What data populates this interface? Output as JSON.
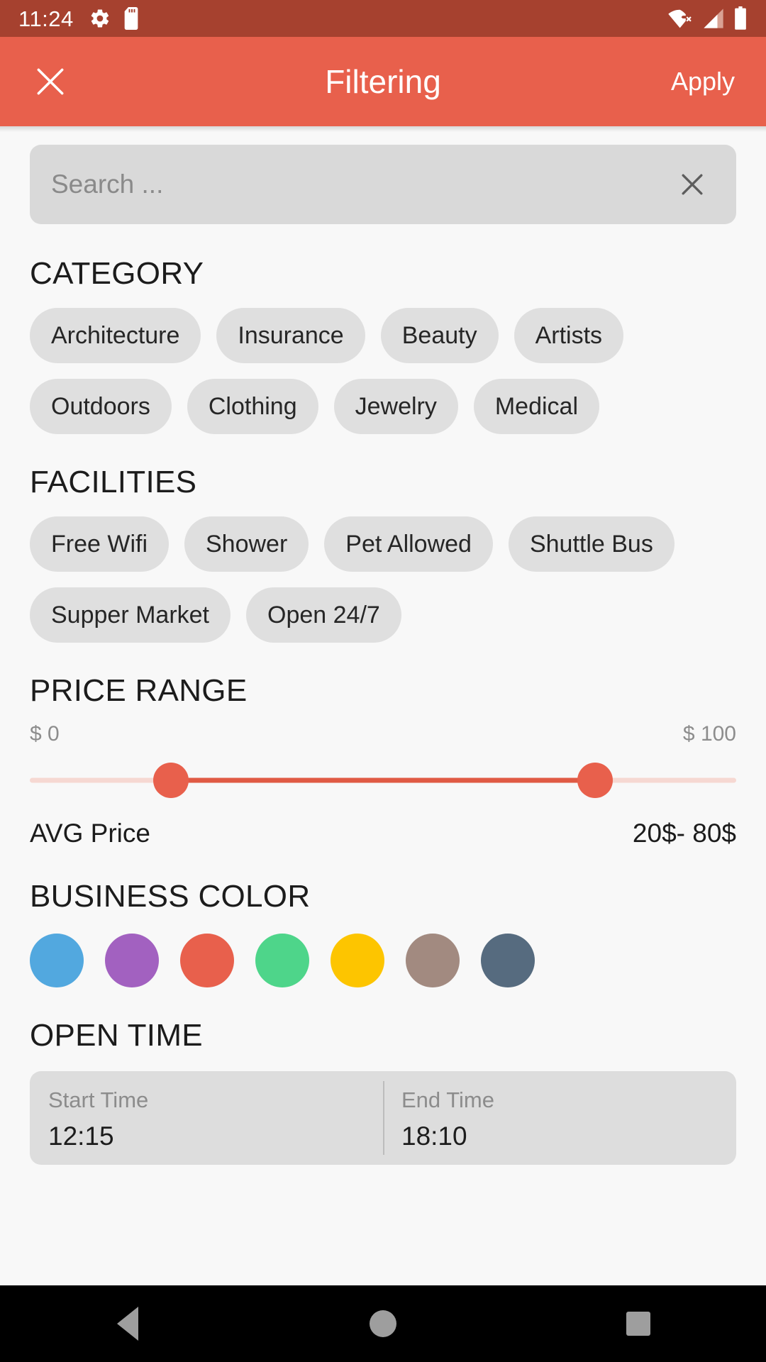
{
  "status_bar": {
    "time": "11:24",
    "icons": [
      "gear-icon",
      "sd-card-icon"
    ],
    "right_icons": [
      "wifi-off-icon",
      "cellular-signal-icon",
      "battery-icon"
    ],
    "background": "#a6412f"
  },
  "app_bar": {
    "close_label": "×",
    "title": "Filtering",
    "apply_label": "Apply",
    "background": "#e8604c"
  },
  "search": {
    "value": "",
    "placeholder": "Search ...",
    "clear_icon": "close-icon"
  },
  "category": {
    "title": "CATEGORY",
    "chips": [
      {
        "label": "Architecture",
        "selected": false
      },
      {
        "label": "Insurance",
        "selected": false
      },
      {
        "label": "Beauty",
        "selected": false
      },
      {
        "label": "Artists",
        "selected": false
      },
      {
        "label": "Outdoors",
        "selected": false
      },
      {
        "label": "Clothing",
        "selected": false
      },
      {
        "label": "Jewelry",
        "selected": false
      },
      {
        "label": "Medical",
        "selected": false
      }
    ]
  },
  "facilities": {
    "title": "FACILITIES",
    "chips": [
      {
        "label": "Free Wifi",
        "selected": false
      },
      {
        "label": "Shower",
        "selected": false
      },
      {
        "label": "Pet Allowed",
        "selected": false
      },
      {
        "label": "Shuttle Bus",
        "selected": false
      },
      {
        "label": "Supper Market",
        "selected": false
      },
      {
        "label": "Open 24/7",
        "selected": false
      }
    ]
  },
  "price_range": {
    "title": "PRICE RANGE",
    "min_label": "$ 0",
    "max_label": "$ 100",
    "min_value": 0,
    "max_value": 100,
    "selected_min": 20,
    "selected_max": 80,
    "avg_label": "AVG Price",
    "avg_value": "20$- 80$",
    "track_color": "#f6d8d2",
    "fill_color": "#e05a44",
    "thumb_color": "#e8604c"
  },
  "business_color": {
    "title": "BUSINESS COLOR",
    "swatches": [
      {
        "name": "blue",
        "hex": "#52a8df"
      },
      {
        "name": "purple",
        "hex": "#a261c0"
      },
      {
        "name": "red",
        "hex": "#e8604c"
      },
      {
        "name": "green",
        "hex": "#4ed58a"
      },
      {
        "name": "yellow",
        "hex": "#fdc500"
      },
      {
        "name": "brown",
        "hex": "#a28a80"
      },
      {
        "name": "slate",
        "hex": "#566b7f"
      }
    ]
  },
  "open_time": {
    "title": "OPEN TIME",
    "start_label": "Start Time",
    "start_value": "12:15",
    "end_label": "End Time",
    "end_value": "18:10"
  },
  "nav_bar": {
    "buttons": [
      "back-button",
      "home-button",
      "recents-button"
    ]
  }
}
